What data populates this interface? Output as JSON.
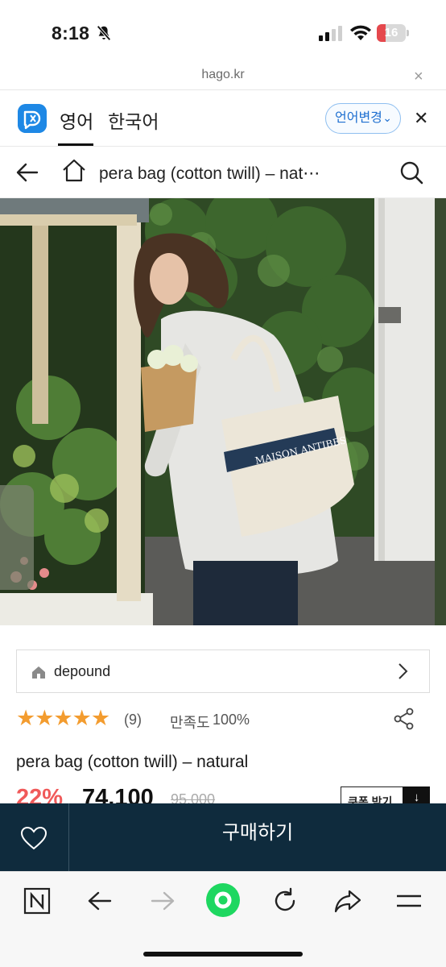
{
  "status_bar": {
    "time": "8:18",
    "battery_level": "16",
    "icons": [
      "bell-slash-icon",
      "cellular-signal-icon",
      "wifi-icon",
      "battery-icon"
    ]
  },
  "browser": {
    "url": "hago.kr",
    "close_symbol": "×"
  },
  "translate_bar": {
    "tabs": [
      {
        "label": "영어",
        "active": true
      },
      {
        "label": "한국어",
        "active": false
      }
    ],
    "change_language_label": "언어변경",
    "change_language_chevron": "⌄",
    "close_symbol": "✕",
    "accent_color": "#1e88e5"
  },
  "page_header": {
    "title": "pera bag (cotton twill) – nat⋯"
  },
  "product": {
    "image_alt": "product photo",
    "brand": "depound",
    "rating_stars": "★★★★★",
    "rating_value": 5,
    "review_count": "(9)",
    "satisfaction_label": "만족도",
    "satisfaction_value": "100%",
    "title": "pera bag (cotton twill) – natural",
    "discount": "22%",
    "sale_price": "74,100",
    "original_price": "95,000",
    "coupon_label": "쿠폰 받기",
    "coupon_icon_glyph": "↓",
    "discount_color": "#f05a5a",
    "star_color": "#f39c2f"
  },
  "action_bar": {
    "buy_label": "구매하기",
    "background": "#0f2b3d"
  },
  "toolbar": {
    "items": [
      "naver-n-icon",
      "back-icon",
      "forward-icon",
      "home-green-icon",
      "reload-icon",
      "share-icon",
      "menu-icon"
    ],
    "home_color": "#1ed760"
  }
}
